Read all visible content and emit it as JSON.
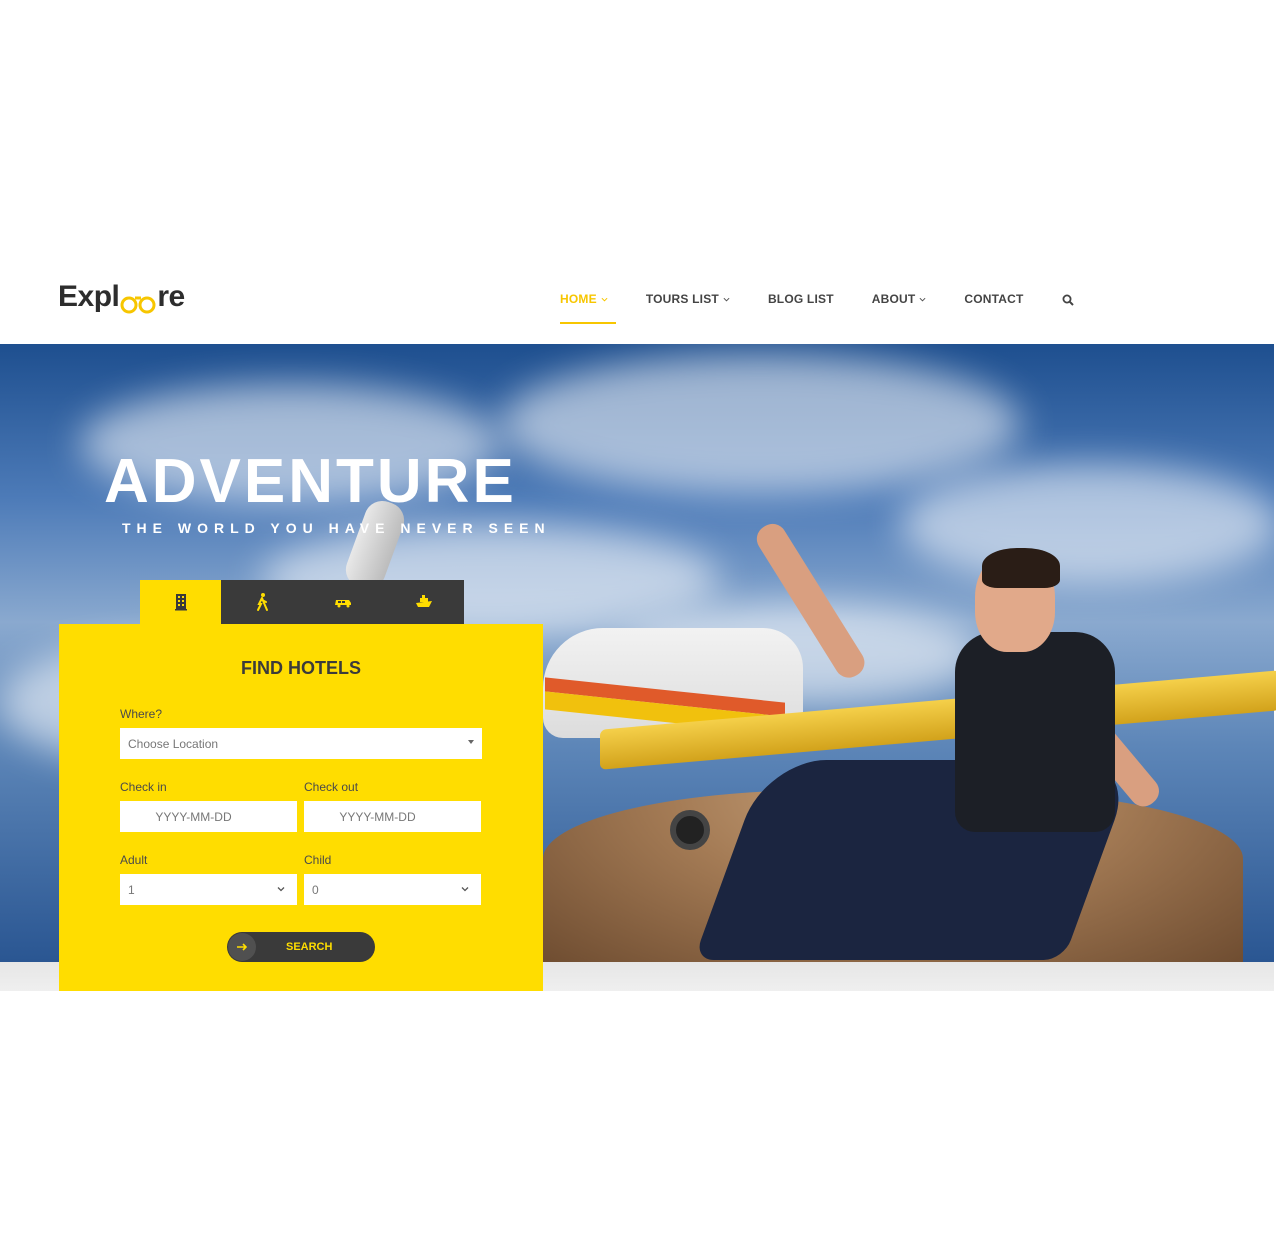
{
  "site": {
    "logo_prefix": "Expl",
    "logo_suffix": "re"
  },
  "nav": {
    "items": [
      {
        "label": "HOME",
        "has_dropdown": true,
        "active": true
      },
      {
        "label": "TOURS LIST",
        "has_dropdown": true,
        "active": false
      },
      {
        "label": "BLOG LIST",
        "has_dropdown": false,
        "active": false
      },
      {
        "label": "ABOUT",
        "has_dropdown": true,
        "active": false
      },
      {
        "label": "CONTACT",
        "has_dropdown": false,
        "active": false
      }
    ],
    "search_icon": "search-icon"
  },
  "hero": {
    "title": "ADVENTURE",
    "subtitle": "THE WORLD YOU HAVE NEVER SEEN"
  },
  "booking": {
    "tabs": [
      {
        "icon": "hotel-icon",
        "active": true
      },
      {
        "icon": "walking-tour-icon",
        "active": false
      },
      {
        "icon": "car-icon",
        "active": false
      },
      {
        "icon": "cruise-icon",
        "active": false
      }
    ],
    "title": "FIND HOTELS",
    "where_label": "Where?",
    "where_placeholder": "Choose Location",
    "checkin_label": "Check in",
    "checkin_placeholder": "YYYY-MM-DD",
    "checkout_label": "Check out",
    "checkout_placeholder": "YYYY-MM-DD",
    "adult_label": "Adult",
    "adult_value": "1",
    "child_label": "Child",
    "child_value": "0",
    "search_label": "SEARCH"
  },
  "colors": {
    "accent": "#ffdd00",
    "nav_active": "#f7c600",
    "dark": "#3a3a3a"
  }
}
